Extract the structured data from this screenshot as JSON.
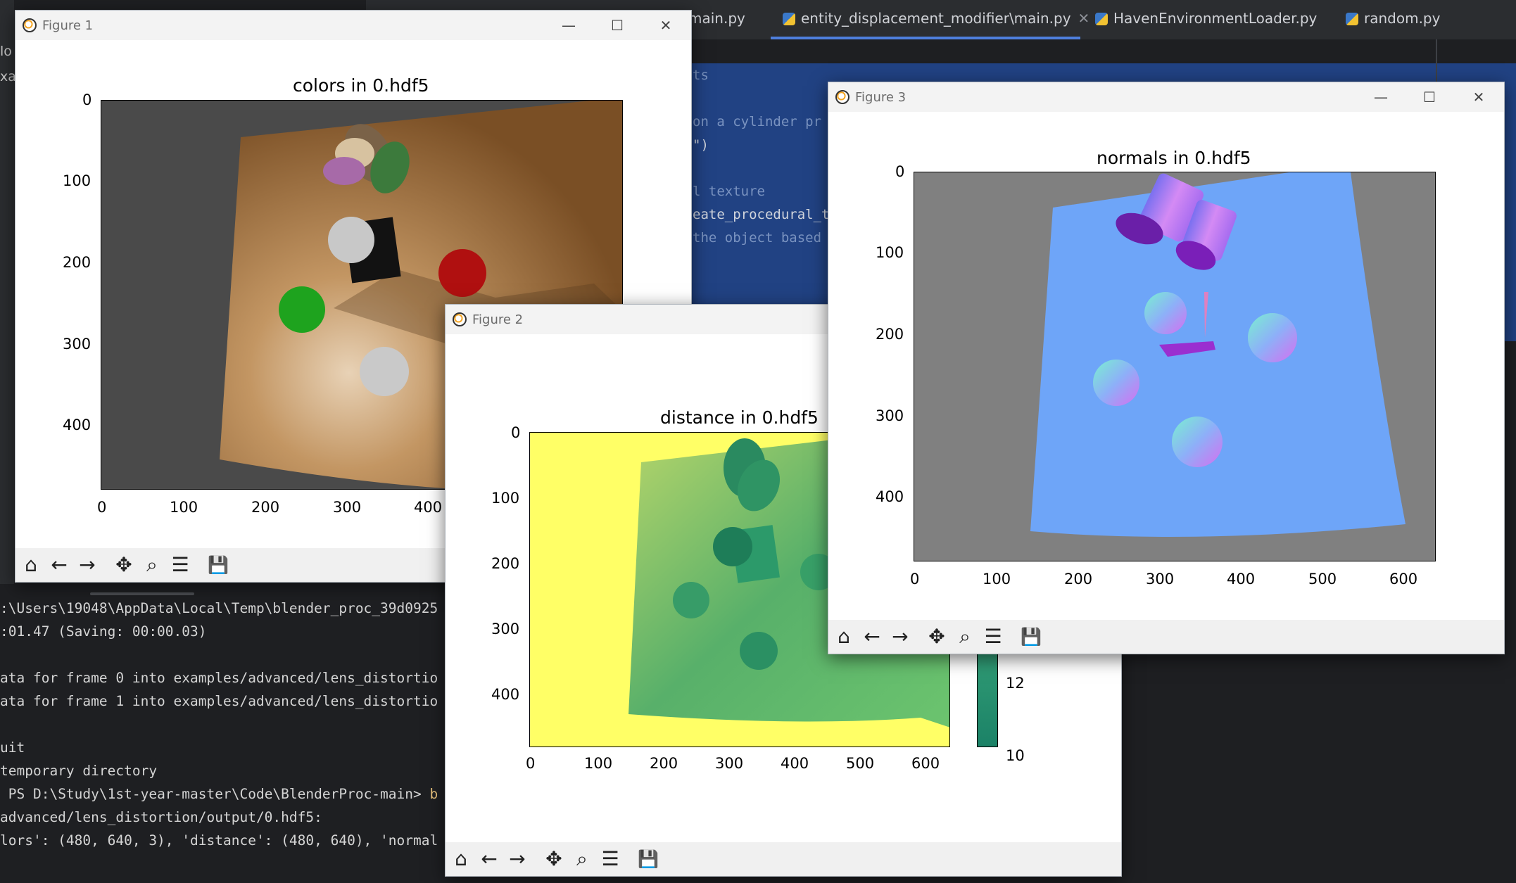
{
  "ide": {
    "tabs": [
      {
        "label": "main.py"
      },
      {
        "label": "entity_displacement_modifier\\main.py"
      },
      {
        "label": "HavenEnvironmentLoader.py"
      },
      {
        "label": "random.py"
      }
    ],
    "close_glyph": "✕",
    "code_lines": [
      "ts",
      "on a cylinder pr",
      "\")",
      "l texture",
      "eate_procedural_t",
      "the object based",
      "~ )"
    ],
    "gutter_text": [
      "lo",
      "xa"
    ],
    "terminal_lines": [
      ":\\Users\\19048\\AppData\\Local\\Temp\\blender_proc_39d0925",
      ":01.47 (Saving: 00:00.03)",
      "ata for frame 0 into examples/advanced/lens_distortio",
      "ata for frame 1 into examples/advanced/lens_distortio",
      "uit",
      "temporary directory",
      "PS D:\\Study\\1st-year-master\\Code\\BlenderProc-main>",
      "b",
      "advanced/lens_distortion/output/0.hdf5:",
      "lors': (480, 640, 3), 'distance': (480, 640), 'normal"
    ]
  },
  "figure1": {
    "window_title": "Figure 1",
    "plot_title": "colors in 0.hdf5",
    "y_ticks": [
      "0",
      "100",
      "200",
      "300",
      "400"
    ],
    "x_ticks": [
      "0",
      "100",
      "200",
      "300",
      "400"
    ]
  },
  "figure2": {
    "window_title": "Figure 2",
    "plot_title": "distance in 0.hdf5",
    "y_ticks": [
      "0",
      "100",
      "200",
      "300",
      "400"
    ],
    "x_ticks": [
      "0",
      "100",
      "200",
      "300",
      "400",
      "500",
      "600"
    ],
    "colorbar_ticks": [
      "12",
      "10"
    ]
  },
  "figure3": {
    "window_title": "Figure 3",
    "plot_title": "normals in 0.hdf5",
    "y_ticks": [
      "0",
      "100",
      "200",
      "300",
      "400"
    ],
    "x_ticks": [
      "0",
      "100",
      "200",
      "300",
      "400",
      "500",
      "600"
    ]
  },
  "window_controls": {
    "minimize": "—",
    "maximize": "☐",
    "close": "✕"
  },
  "toolbar_glyphs": {
    "home": "⌂",
    "back": "←",
    "forward": "→",
    "pan": "✥",
    "zoom": "⌕",
    "configure": "☰",
    "save": "💾"
  },
  "colors": {
    "ide_bg": "#1e1f22",
    "editor_selection": "#214283",
    "normals_bg": "#6ea5f8",
    "distance_far": "#ffff66",
    "distance_near": "#1f8a70"
  }
}
